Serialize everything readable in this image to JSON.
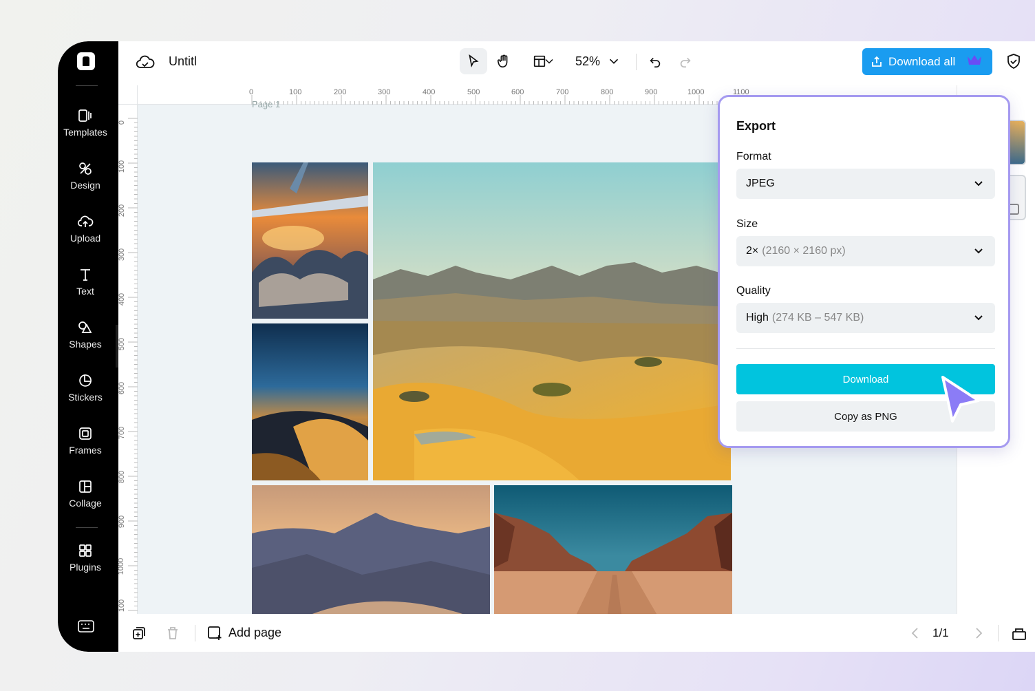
{
  "sidebar": {
    "items": [
      {
        "label": "Templates",
        "icon": "templates-icon"
      },
      {
        "label": "Design",
        "icon": "design-icon"
      },
      {
        "label": "Upload",
        "icon": "upload-icon"
      },
      {
        "label": "Text",
        "icon": "text-icon"
      },
      {
        "label": "Shapes",
        "icon": "shapes-icon"
      },
      {
        "label": "Stickers",
        "icon": "stickers-icon"
      },
      {
        "label": "Frames",
        "icon": "frames-icon"
      },
      {
        "label": "Collage",
        "icon": "collage-icon"
      },
      {
        "label": "Plugins",
        "icon": "plugins-icon"
      }
    ]
  },
  "topbar": {
    "title": "Untitl",
    "zoom": "52%",
    "download_all": "Download all"
  },
  "ruler": {
    "top": [
      "0",
      "100",
      "200",
      "300",
      "400",
      "500",
      "600",
      "700",
      "800",
      "900",
      "1000",
      "1100"
    ],
    "left": [
      "0",
      "100",
      "200",
      "300",
      "400",
      "500",
      "600",
      "700",
      "800",
      "900",
      "1000",
      "100"
    ]
  },
  "canvas": {
    "page_label": "Page 1"
  },
  "export": {
    "title": "Export",
    "format_label": "Format",
    "format_value": "JPEG",
    "size_label": "Size",
    "size_value": "2×",
    "size_detail": "(2160 × 2160 px)",
    "quality_label": "Quality",
    "quality_value": "High",
    "quality_detail": "(274 KB – 547 KB)",
    "download_button": "Download",
    "copy_button": "Copy as PNG"
  },
  "bottombar": {
    "add_page": "Add page",
    "pager": "1/1"
  },
  "colors": {
    "accent_download_all": "#1a9cf0",
    "accent_download": "#01c4de",
    "popup_border": "#a59af0",
    "cursor": "#8b7cf6"
  }
}
